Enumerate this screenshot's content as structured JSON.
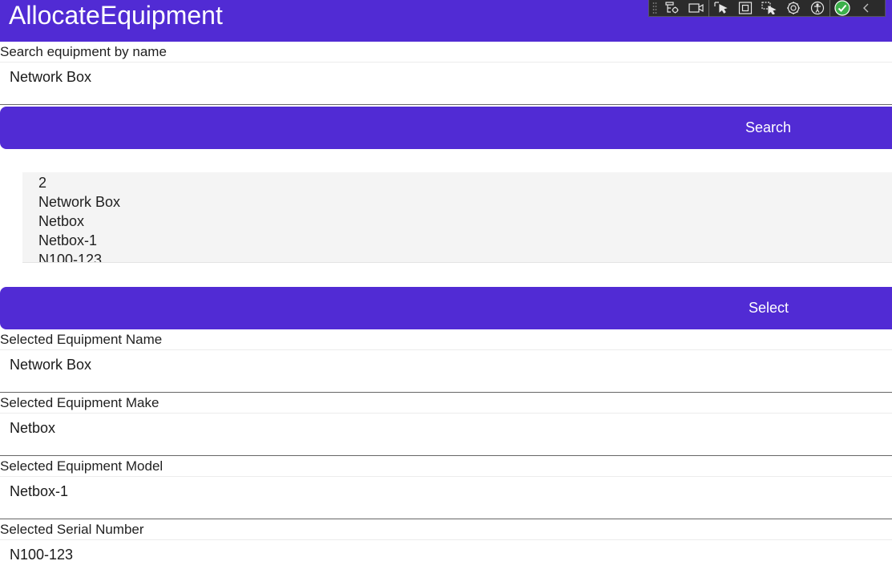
{
  "app": {
    "title": "AllocateEquipment"
  },
  "devtools": {
    "icons": [
      "grip-icon",
      "live-visual-tree-icon",
      "record-icon",
      "select-element-icon",
      "display-layout-adorners-icon",
      "track-focused-element-icon",
      "binding-failures-icon",
      "accessibility-icon",
      "check-icon",
      "collapse-chevron-icon"
    ],
    "accent_check": "#3cb04a"
  },
  "search": {
    "label": "Search equipment by name",
    "value": "Network Box",
    "button_label": "Search"
  },
  "results": {
    "items": [
      "2",
      "Network Box",
      "Netbox",
      "Netbox-1",
      "N100-123"
    ]
  },
  "select_button": {
    "label": "Select"
  },
  "selected": {
    "name_label": "Selected Equipment Name",
    "name_value": "Network Box",
    "make_label": "Selected Equipment Make",
    "make_value": "Netbox",
    "model_label": "Selected Equipment Model",
    "model_value": "Netbox-1",
    "serial_label": "Selected Serial Number",
    "serial_value": "N100-123"
  },
  "colors": {
    "primary": "#512bd4",
    "list_bg": "#f4f4f4"
  }
}
